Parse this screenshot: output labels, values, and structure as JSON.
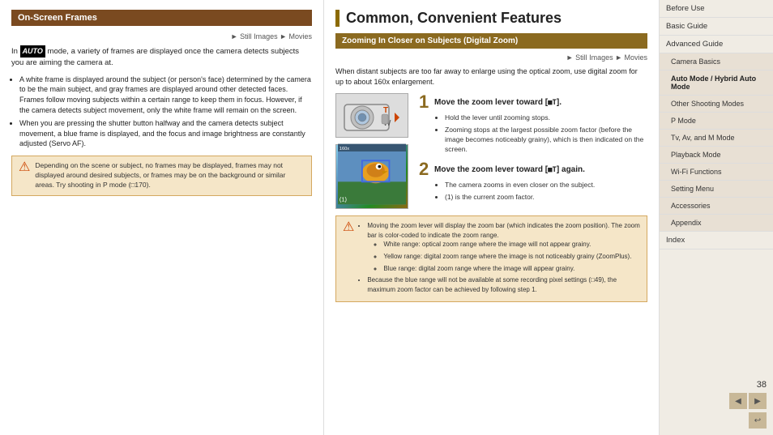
{
  "left": {
    "title": "On-Screen Frames",
    "still_movies": "► Still Images  ► Movies",
    "intro": "In [AUTO] mode, a variety of frames are displayed once the camera detects subjects you are aiming the camera at.",
    "bullets": [
      "A white frame is displayed around the subject (or person's face) determined by the camera to be the main subject, and gray frames are displayed around other detected faces. Frames follow moving subjects within a certain range to keep them in focus. However, if the camera detects subject movement, only the white frame will remain on the screen.",
      "When you are pressing the shutter button halfway and the camera detects subject movement, a blue frame is displayed, and the focus and image brightness are constantly adjusted (Servo AF)."
    ],
    "note": "Depending on the scene or subject, no frames may be displayed, frames may not displayed around desired subjects, or frames may be on the background or similar areas. Try shooting in P mode (□170)."
  },
  "middle": {
    "main_title": "Common, Convenient Features",
    "sub_title": "Zooming In Closer on Subjects (Digital Zoom)",
    "still_movies": "► Still Images  ► Movies",
    "intro": "When distant subjects are too far away to enlarge using the optical zoom, use digital zoom for up to about 160x enlargement.",
    "step1_title": "Move the zoom lever toward [",
    "step1_symbol": "].",
    "step1_bullets": [
      "Hold the lever until zooming stops.",
      "Zooming stops at the largest possible zoom factor (before the image becomes noticeably grainy), which is then indicated on the screen."
    ],
    "step2_title": "Move the zoom lever toward [",
    "step2_symbol": "] again.",
    "step2_bullets": [
      "The camera zooms in even closer on the subject.",
      "(1) is the current zoom factor."
    ],
    "label_1": "(1)",
    "note_bullets": [
      "Moving the zoom lever will display the zoom bar (which indicates the zoom position). The zoom bar is color-coded to indicate the zoom range.",
      "White range: optical zoom range where the image will not appear grainy.",
      "Yellow range: digital zoom range where the image is not noticeably grainy (ZoomPlus).",
      "Blue range: digital zoom range where the image will appear grainy.",
      "Because the blue range will not be available at some recording pixel settings (□49), the maximum zoom factor can be achieved by following step 1."
    ]
  },
  "sidebar": {
    "items": [
      {
        "label": "Before Use",
        "highlighted": false
      },
      {
        "label": "Basic Guide",
        "highlighted": false
      },
      {
        "label": "Advanced Guide",
        "highlighted": false
      },
      {
        "label": "Camera Basics",
        "highlighted": false,
        "sub": true
      },
      {
        "label": "Auto Mode / Hybrid Auto Mode",
        "highlighted": true,
        "sub": true
      },
      {
        "label": "Other Shooting Modes",
        "highlighted": false,
        "sub": true
      },
      {
        "label": "P Mode",
        "highlighted": false,
        "sub": true
      },
      {
        "label": "Tv, Av, and M Mode",
        "highlighted": false,
        "sub": true
      },
      {
        "label": "Playback Mode",
        "highlighted": false,
        "sub": true
      },
      {
        "label": "Wi-Fi Functions",
        "highlighted": false,
        "sub": true
      },
      {
        "label": "Setting Menu",
        "highlighted": false,
        "sub": true
      },
      {
        "label": "Accessories",
        "highlighted": false,
        "sub": true
      },
      {
        "label": "Appendix",
        "highlighted": false,
        "sub": true
      },
      {
        "label": "Index",
        "highlighted": false
      }
    ],
    "page_number": "38",
    "prev_label": "◀",
    "next_label": "▶",
    "home_label": "↩"
  }
}
